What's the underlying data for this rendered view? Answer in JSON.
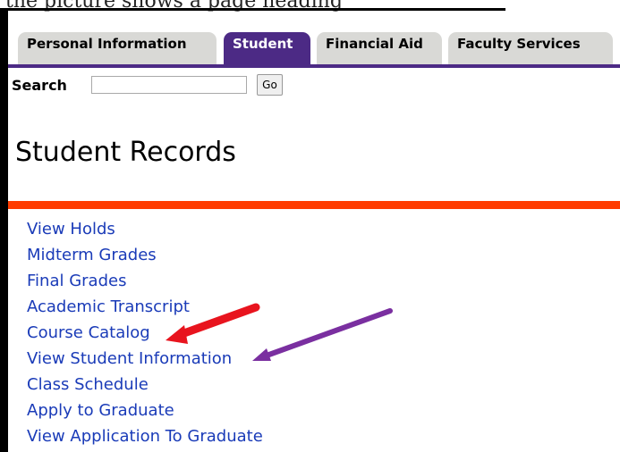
{
  "cropped_caption": "the picture shows a page heading",
  "tabs": [
    {
      "label": "Personal Information",
      "active": false
    },
    {
      "label": "Student",
      "active": true
    },
    {
      "label": "Financial Aid",
      "active": false
    },
    {
      "label": "Faculty Services",
      "active": false
    }
  ],
  "search": {
    "label": "Search",
    "value": "",
    "placeholder": "",
    "go_label": "Go"
  },
  "page_title": "Student Records",
  "links": [
    "View Holds",
    "Midterm Grades",
    "Final Grades",
    "Academic Transcript",
    "Course Catalog",
    "View Student Information",
    "Class Schedule",
    "Apply to Graduate",
    "View Application To Graduate"
  ],
  "colors": {
    "tab_active": "#4c2a85",
    "tab_inactive": "#d9d9d6",
    "rule": "#ff3c00",
    "link": "#1a3bb8",
    "arrow_red": "#e8141e",
    "arrow_purple": "#7a2fa0"
  },
  "annotations": [
    {
      "type": "arrow",
      "color": "red",
      "points_to": "Course Catalog"
    },
    {
      "type": "arrow",
      "color": "purple",
      "points_to": "View Student Information"
    }
  ]
}
